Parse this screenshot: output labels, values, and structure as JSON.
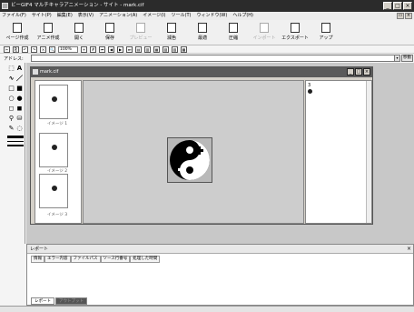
{
  "window": {
    "title": "ビーGIF4 マルチキャラアニメーション - サイト - mark.cif"
  },
  "menu": [
    "ファイル(F)",
    "サイト(P)",
    "編集(E)",
    "表示(V)",
    "アニメーション(A)",
    "イメージ(I)",
    "ツール(T)",
    "ウィンドウ(W)",
    "ヘルプ(H)"
  ],
  "toolbar": [
    {
      "label": "ページ作成",
      "icon": "page-icon",
      "enabled": true
    },
    {
      "label": "アニメ作成",
      "icon": "anim-icon",
      "enabled": true
    },
    {
      "label": "開く",
      "icon": "open-icon",
      "enabled": true
    },
    {
      "label": "保存",
      "icon": "save-icon",
      "enabled": true
    },
    {
      "label": "プレビュー",
      "icon": "preview-icon",
      "enabled": false
    },
    {
      "label": "減色",
      "icon": "reduce-icon",
      "enabled": true
    },
    {
      "label": "最適",
      "icon": "optimize-icon",
      "enabled": true
    },
    {
      "label": "圧縮",
      "icon": "compress-icon",
      "enabled": true
    },
    {
      "label": "インポート",
      "icon": "import-icon",
      "enabled": false
    },
    {
      "label": "エクスポート",
      "icon": "export-icon",
      "enabled": true
    },
    {
      "label": "アップ",
      "icon": "upload-icon",
      "enabled": true
    }
  ],
  "zoom": "100%",
  "address": {
    "label": "アドレス:",
    "value": "",
    "go": "移動"
  },
  "child": {
    "title": "mark.cif"
  },
  "thumbnails": [
    {
      "label": "イメージ 1"
    },
    {
      "label": "イメージ 2"
    },
    {
      "label": "イメージ 3"
    }
  ],
  "right_panel": {
    "header": "3"
  },
  "report": {
    "title": "レポート",
    "columns": [
      "情報",
      "エラー内容",
      "ファイルパス",
      "ソース行番号",
      "処理した時間"
    ],
    "tabs": [
      "レポート",
      "アウトプット"
    ]
  }
}
